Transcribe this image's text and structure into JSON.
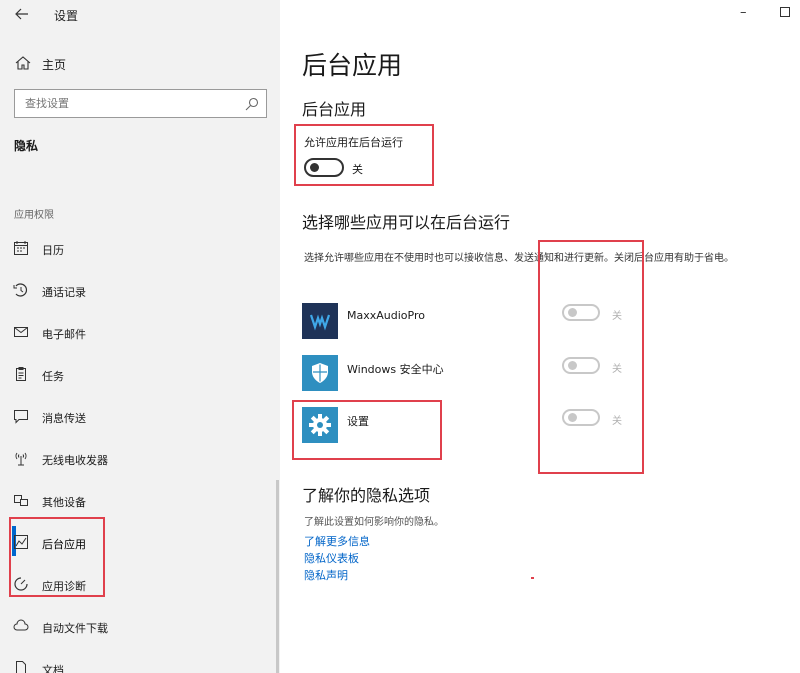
{
  "window": {
    "title": "设置",
    "back_icon": "back-arrow-icon",
    "minimize_glyph": "–",
    "maximize_icon": "maximize-icon"
  },
  "sidebar": {
    "home_label": "主页",
    "search_placeholder": "查找设置",
    "section_title": "隐私",
    "permissions_heading": "应用权限",
    "items": [
      {
        "label": "日历",
        "icon": "calendar-icon"
      },
      {
        "label": "通话记录",
        "icon": "call-history-icon"
      },
      {
        "label": "电子邮件",
        "icon": "mail-icon"
      },
      {
        "label": "任务",
        "icon": "tasks-icon"
      },
      {
        "label": "消息传送",
        "icon": "messaging-icon"
      },
      {
        "label": "无线电收发器",
        "icon": "radio-icon"
      },
      {
        "label": "其他设备",
        "icon": "other-devices-icon"
      },
      {
        "label": "后台应用",
        "icon": "background-apps-icon",
        "active": true
      },
      {
        "label": "应用诊断",
        "icon": "app-diagnostics-icon"
      },
      {
        "label": "自动文件下载",
        "icon": "cloud-download-icon"
      },
      {
        "label": "文档",
        "icon": "documents-icon"
      }
    ]
  },
  "main": {
    "page_title": "后台应用",
    "section_title": "后台应用",
    "allow_label": "允许应用在后台运行",
    "allow_state": "关",
    "choose_title": "选择哪些应用可以在后台运行",
    "description": "选择允许哪些应用在不使用时也可以接收信息、发送通知和进行更新。关闭后台应用有助于省电。",
    "apps": [
      {
        "name": "MaxxAudioPro",
        "state": "关",
        "icon": "maxxaudio-icon",
        "tile_color": "#1f3358"
      },
      {
        "name": "Windows 安全中心",
        "state": "关",
        "icon": "shield-icon",
        "tile_color": "#2e8fc0"
      },
      {
        "name": "设置",
        "state": "关",
        "icon": "gear-icon",
        "tile_color": "#2e8fc0"
      }
    ],
    "learn_title": "了解你的隐私选项",
    "learn_desc": "了解此设置如何影响你的隐私。",
    "links": [
      "了解更多信息",
      "隐私仪表板",
      "隐私声明"
    ]
  },
  "colors": {
    "accent": "#0064c8",
    "annotation": "#e0404c",
    "sidebar_bg": "#f2f2f2"
  }
}
